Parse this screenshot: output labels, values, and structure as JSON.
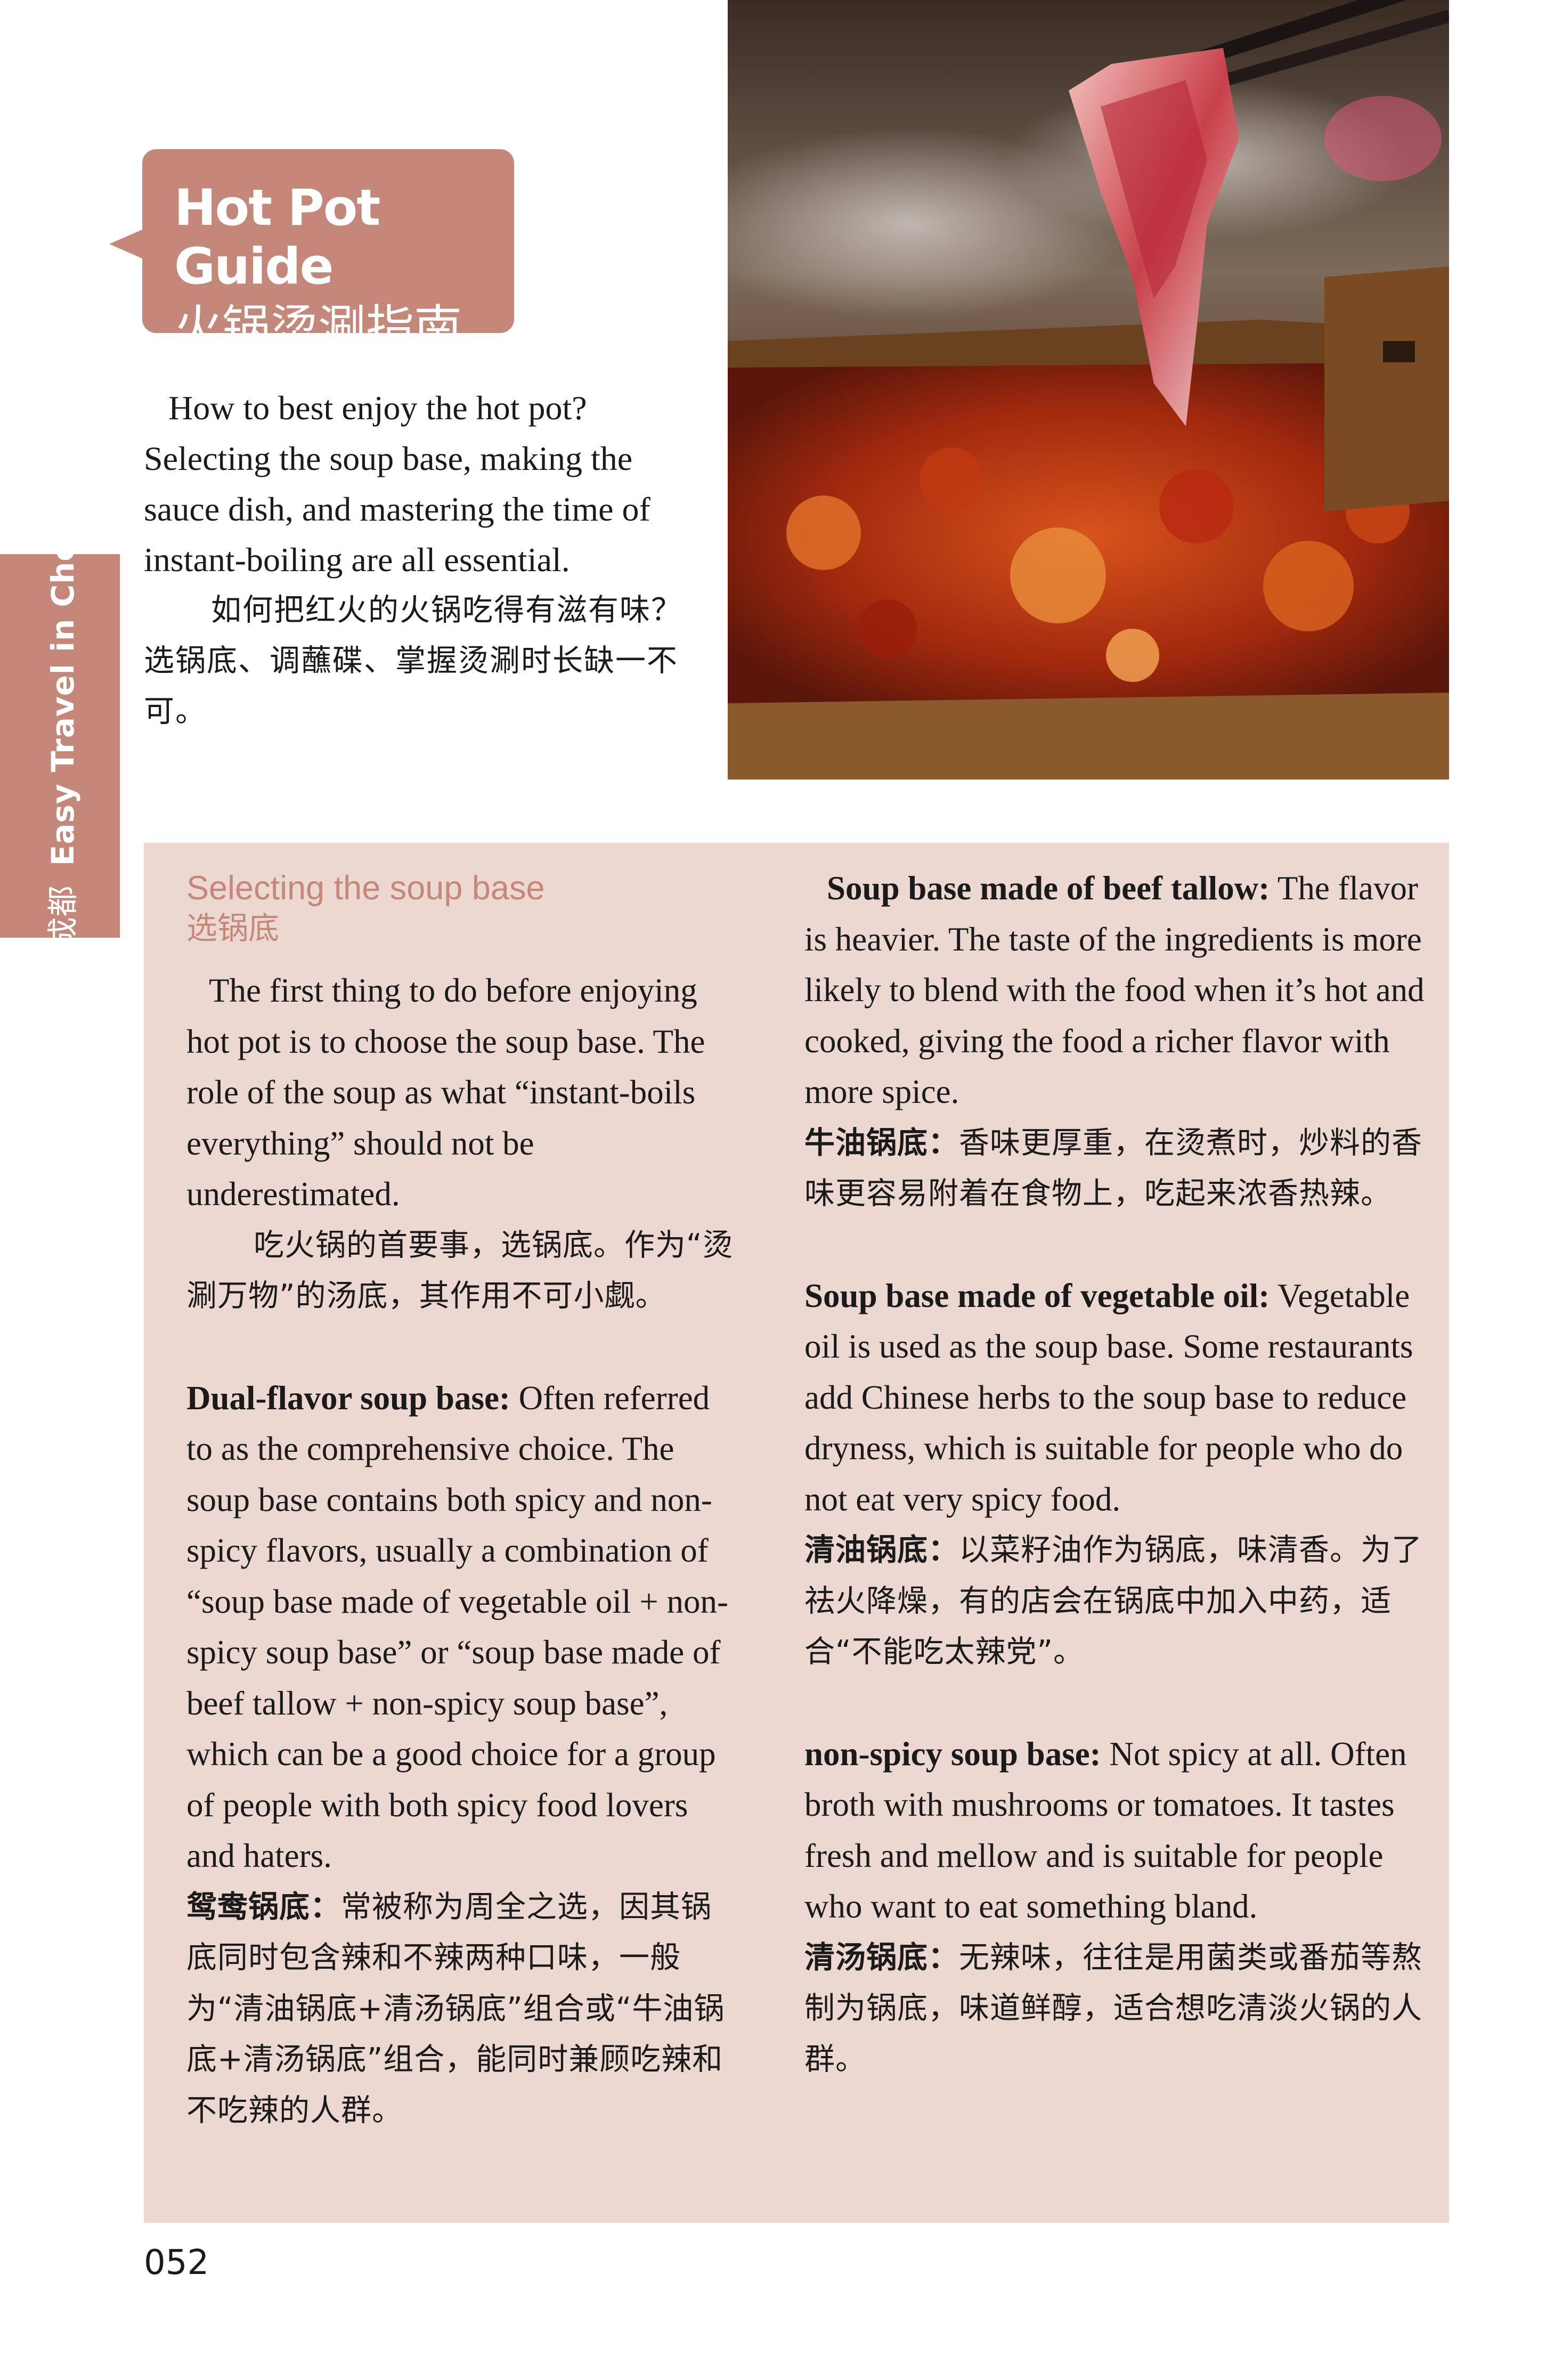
{
  "title": {
    "en": "Hot Pot Guide",
    "zh": "火锅烫涮指南"
  },
  "side_tab": {
    "zh": "悠游，成都",
    "en": "Easy Travel in Chengdu"
  },
  "intro": {
    "en": "How to best enjoy the hot pot? Selecting the soup base, making the sauce dish, and mastering the time of instant-boiling are all essential.",
    "zh": "如何把红火的火锅吃得有滋有味？选锅底、调蘸碟、掌握烫涮时长缺一不可。"
  },
  "section": {
    "heading_en": "Selecting the soup base",
    "heading_zh": "选锅底",
    "lead_en": "The first thing to do before enjoying hot pot is to choose the soup base. The role of the soup as what “instant-boils everything” should not be underestimated.",
    "lead_zh": "吃火锅的首要事，选锅底。作为“烫涮万物”的汤底，其作用不可小觑。"
  },
  "items": [
    {
      "name_en": "Dual-flavor soup base:",
      "desc_en": "Often referred to as the comprehensive choice. The soup base contains both spicy and non-spicy flavors, usually a combination of “soup base made of vegetable oil + non-spicy soup base” or “soup base made of beef tallow + non-spicy soup base”, which can be a good choice for a group of people with both spicy food lovers and haters.",
      "name_zh": "鸳鸯锅底：",
      "desc_zh": "常被称为周全之选，因其锅底同时包含辣和不辣两种口味，一般为“清油锅底+清汤锅底”组合或“牛油锅底+清汤锅底”组合，能同时兼顾吃辣和不吃辣的人群。"
    },
    {
      "name_en": "Soup base made of beef tallow:",
      "desc_en": "The flavor is heavier. The taste of the ingredients is more likely to blend with the food when it’s hot and cooked, giving the food a richer flavor with more spice.",
      "name_zh": "牛油锅底：",
      "desc_zh": "香味更厚重，在烫煮时，炒料的香味更容易附着在食物上，吃起来浓香热辣。"
    },
    {
      "name_en": "Soup base made of vegetable oil:",
      "desc_en": "Vegetable oil is used as the soup base. Some restaurants add Chinese herbs to the soup base to reduce dryness, which is suitable for people who do not eat very spicy food.",
      "name_zh": "清油锅底：",
      "desc_zh": "以菜籽油作为锅底，味清香。为了祛火降燥，有的店会在锅底中加入中药，适合“不能吃太辣党”。"
    },
    {
      "name_en": "non-spicy soup base:",
      "desc_en": "Not spicy at all. Often broth with mushrooms or tomatoes. It tastes fresh and mellow and is suitable for people who want to eat something bland.",
      "name_zh": "清汤锅底：",
      "desc_zh": "无辣味，往往是用菌类或番茄等熬制为锅底，味道鲜醇，适合想吃清淡火锅的人群。"
    }
  ],
  "page_number": "052",
  "colors": {
    "accent": "#c4887b",
    "panel": "#ecd7d1"
  }
}
